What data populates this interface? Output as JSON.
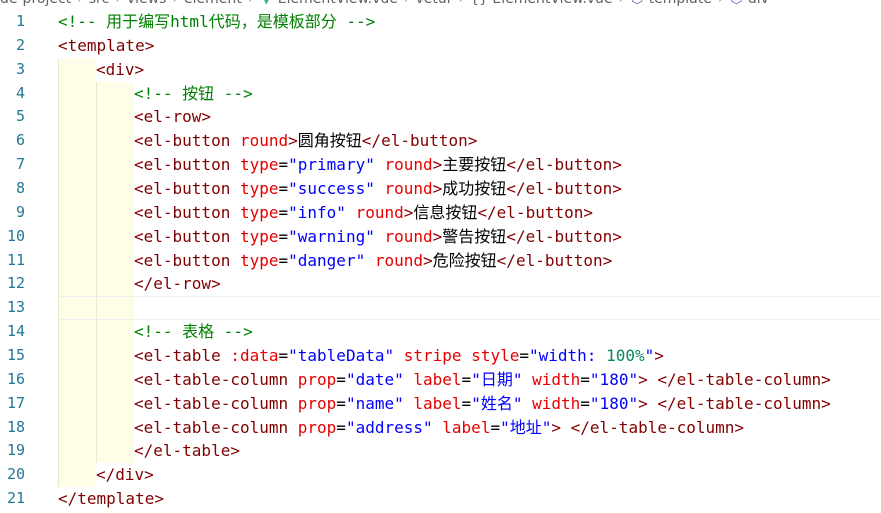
{
  "breadcrumb": {
    "items": [
      "de-project",
      "src",
      "views",
      "element",
      "ElementView.vue",
      "vetur",
      "{} ElementView.vue",
      "template",
      "div"
    ],
    "icons": [
      "",
      "",
      "",
      "",
      "vue-icon",
      "",
      "",
      "cube-icon",
      "cube-icon"
    ]
  },
  "colors": {
    "comment": "#008000",
    "tag": "#800000",
    "attribute": "#e50000",
    "string": "#0000ff",
    "line_number": "#237893",
    "indent_guide": "#fefde8"
  },
  "editor": {
    "current_line": 13,
    "lines": [
      {
        "n": "1",
        "indent": 0,
        "tokens": [
          {
            "t": "comment",
            "v": "<!-- 用于编写html代码，是模板部分 -->"
          }
        ]
      },
      {
        "n": "2",
        "indent": 0,
        "tokens": [
          {
            "t": "tag",
            "v": "<template>"
          }
        ]
      },
      {
        "n": "3",
        "indent": 1,
        "tokens": [
          {
            "t": "tag",
            "v": "<div>"
          }
        ]
      },
      {
        "n": "4",
        "indent": 2,
        "tokens": [
          {
            "t": "comment",
            "v": "<!-- 按钮 -->"
          }
        ]
      },
      {
        "n": "5",
        "indent": 2,
        "tokens": [
          {
            "t": "tag",
            "v": "<el-row>"
          }
        ]
      },
      {
        "n": "6",
        "indent": 2,
        "tokens": [
          {
            "t": "tag",
            "v": "<el-button "
          },
          {
            "t": "attr",
            "v": "round"
          },
          {
            "t": "tag",
            "v": ">"
          },
          {
            "t": "text",
            "v": "圆角按钮"
          },
          {
            "t": "tag",
            "v": "</el-button>"
          }
        ]
      },
      {
        "n": "7",
        "indent": 2,
        "tokens": [
          {
            "t": "tag",
            "v": "<el-button "
          },
          {
            "t": "attr",
            "v": "type"
          },
          {
            "t": "text",
            "v": "="
          },
          {
            "t": "value",
            "v": "\"primary\""
          },
          {
            "t": "text",
            "v": " "
          },
          {
            "t": "attr",
            "v": "round"
          },
          {
            "t": "tag",
            "v": ">"
          },
          {
            "t": "text",
            "v": "主要按钮"
          },
          {
            "t": "tag",
            "v": "</el-button>"
          }
        ]
      },
      {
        "n": "8",
        "indent": 2,
        "tokens": [
          {
            "t": "tag",
            "v": "<el-button "
          },
          {
            "t": "attr",
            "v": "type"
          },
          {
            "t": "text",
            "v": "="
          },
          {
            "t": "value",
            "v": "\"success\""
          },
          {
            "t": "text",
            "v": " "
          },
          {
            "t": "attr",
            "v": "round"
          },
          {
            "t": "tag",
            "v": ">"
          },
          {
            "t": "text",
            "v": "成功按钮"
          },
          {
            "t": "tag",
            "v": "</el-button>"
          }
        ]
      },
      {
        "n": "9",
        "indent": 2,
        "tokens": [
          {
            "t": "tag",
            "v": "<el-button "
          },
          {
            "t": "attr",
            "v": "type"
          },
          {
            "t": "text",
            "v": "="
          },
          {
            "t": "value",
            "v": "\"info\""
          },
          {
            "t": "text",
            "v": " "
          },
          {
            "t": "attr",
            "v": "round"
          },
          {
            "t": "tag",
            "v": ">"
          },
          {
            "t": "text",
            "v": "信息按钮"
          },
          {
            "t": "tag",
            "v": "</el-button>"
          }
        ]
      },
      {
        "n": "10",
        "indent": 2,
        "tokens": [
          {
            "t": "tag",
            "v": "<el-button "
          },
          {
            "t": "attr",
            "v": "type"
          },
          {
            "t": "text",
            "v": "="
          },
          {
            "t": "value",
            "v": "\"warning\""
          },
          {
            "t": "text",
            "v": " "
          },
          {
            "t": "attr",
            "v": "round"
          },
          {
            "t": "tag",
            "v": ">"
          },
          {
            "t": "text",
            "v": "警告按钮"
          },
          {
            "t": "tag",
            "v": "</el-button>"
          }
        ]
      },
      {
        "n": "11",
        "indent": 2,
        "tokens": [
          {
            "t": "tag",
            "v": "<el-button "
          },
          {
            "t": "attr",
            "v": "type"
          },
          {
            "t": "text",
            "v": "="
          },
          {
            "t": "value",
            "v": "\"danger\""
          },
          {
            "t": "text",
            "v": " "
          },
          {
            "t": "attr",
            "v": "round"
          },
          {
            "t": "tag",
            "v": ">"
          },
          {
            "t": "text",
            "v": "危险按钮"
          },
          {
            "t": "tag",
            "v": "</el-button>"
          }
        ]
      },
      {
        "n": "12",
        "indent": 2,
        "tokens": [
          {
            "t": "tag",
            "v": "</el-row>"
          }
        ]
      },
      {
        "n": "13",
        "indent": 2,
        "tokens": []
      },
      {
        "n": "14",
        "indent": 2,
        "tokens": [
          {
            "t": "comment",
            "v": "<!-- 表格 -->"
          }
        ]
      },
      {
        "n": "15",
        "indent": 2,
        "tokens": [
          {
            "t": "tag",
            "v": "<el-table "
          },
          {
            "t": "attr",
            "v": ":data"
          },
          {
            "t": "text",
            "v": "="
          },
          {
            "t": "value",
            "v": "\"tableData\""
          },
          {
            "t": "text",
            "v": " "
          },
          {
            "t": "attr",
            "v": "stripe"
          },
          {
            "t": "text",
            "v": " "
          },
          {
            "t": "attr",
            "v": "style"
          },
          {
            "t": "text",
            "v": "="
          },
          {
            "t": "value",
            "v": "\"width: "
          },
          {
            "t": "num",
            "v": "100%"
          },
          {
            "t": "value",
            "v": "\""
          },
          {
            "t": "tag",
            "v": ">"
          }
        ]
      },
      {
        "n": "16",
        "indent": 2,
        "tokens": [
          {
            "t": "tag",
            "v": "<el-table-column "
          },
          {
            "t": "attr",
            "v": "prop"
          },
          {
            "t": "text",
            "v": "="
          },
          {
            "t": "value",
            "v": "\"date\""
          },
          {
            "t": "text",
            "v": " "
          },
          {
            "t": "attr",
            "v": "label"
          },
          {
            "t": "text",
            "v": "="
          },
          {
            "t": "value",
            "v": "\"日期\""
          },
          {
            "t": "text",
            "v": " "
          },
          {
            "t": "attr",
            "v": "width"
          },
          {
            "t": "text",
            "v": "="
          },
          {
            "t": "value",
            "v": "\"180\""
          },
          {
            "t": "tag",
            "v": "> </el-table-column>"
          }
        ]
      },
      {
        "n": "17",
        "indent": 2,
        "tokens": [
          {
            "t": "tag",
            "v": "<el-table-column "
          },
          {
            "t": "attr",
            "v": "prop"
          },
          {
            "t": "text",
            "v": "="
          },
          {
            "t": "value",
            "v": "\"name\""
          },
          {
            "t": "text",
            "v": " "
          },
          {
            "t": "attr",
            "v": "label"
          },
          {
            "t": "text",
            "v": "="
          },
          {
            "t": "value",
            "v": "\"姓名\""
          },
          {
            "t": "text",
            "v": " "
          },
          {
            "t": "attr",
            "v": "width"
          },
          {
            "t": "text",
            "v": "="
          },
          {
            "t": "value",
            "v": "\"180\""
          },
          {
            "t": "tag",
            "v": "> </el-table-column>"
          }
        ]
      },
      {
        "n": "18",
        "indent": 2,
        "tokens": [
          {
            "t": "tag",
            "v": "<el-table-column "
          },
          {
            "t": "attr",
            "v": "prop"
          },
          {
            "t": "text",
            "v": "="
          },
          {
            "t": "value",
            "v": "\"address\""
          },
          {
            "t": "text",
            "v": " "
          },
          {
            "t": "attr",
            "v": "label"
          },
          {
            "t": "text",
            "v": "="
          },
          {
            "t": "value",
            "v": "\"地址\""
          },
          {
            "t": "tag",
            "v": "> </el-table-column>"
          }
        ]
      },
      {
        "n": "19",
        "indent": 2,
        "tokens": [
          {
            "t": "tag",
            "v": "</el-table>"
          }
        ]
      },
      {
        "n": "20",
        "indent": 1,
        "tokens": [
          {
            "t": "tag",
            "v": "</div>"
          }
        ]
      },
      {
        "n": "21",
        "indent": 0,
        "tokens": [
          {
            "t": "tag",
            "v": "</template>"
          }
        ]
      }
    ]
  }
}
